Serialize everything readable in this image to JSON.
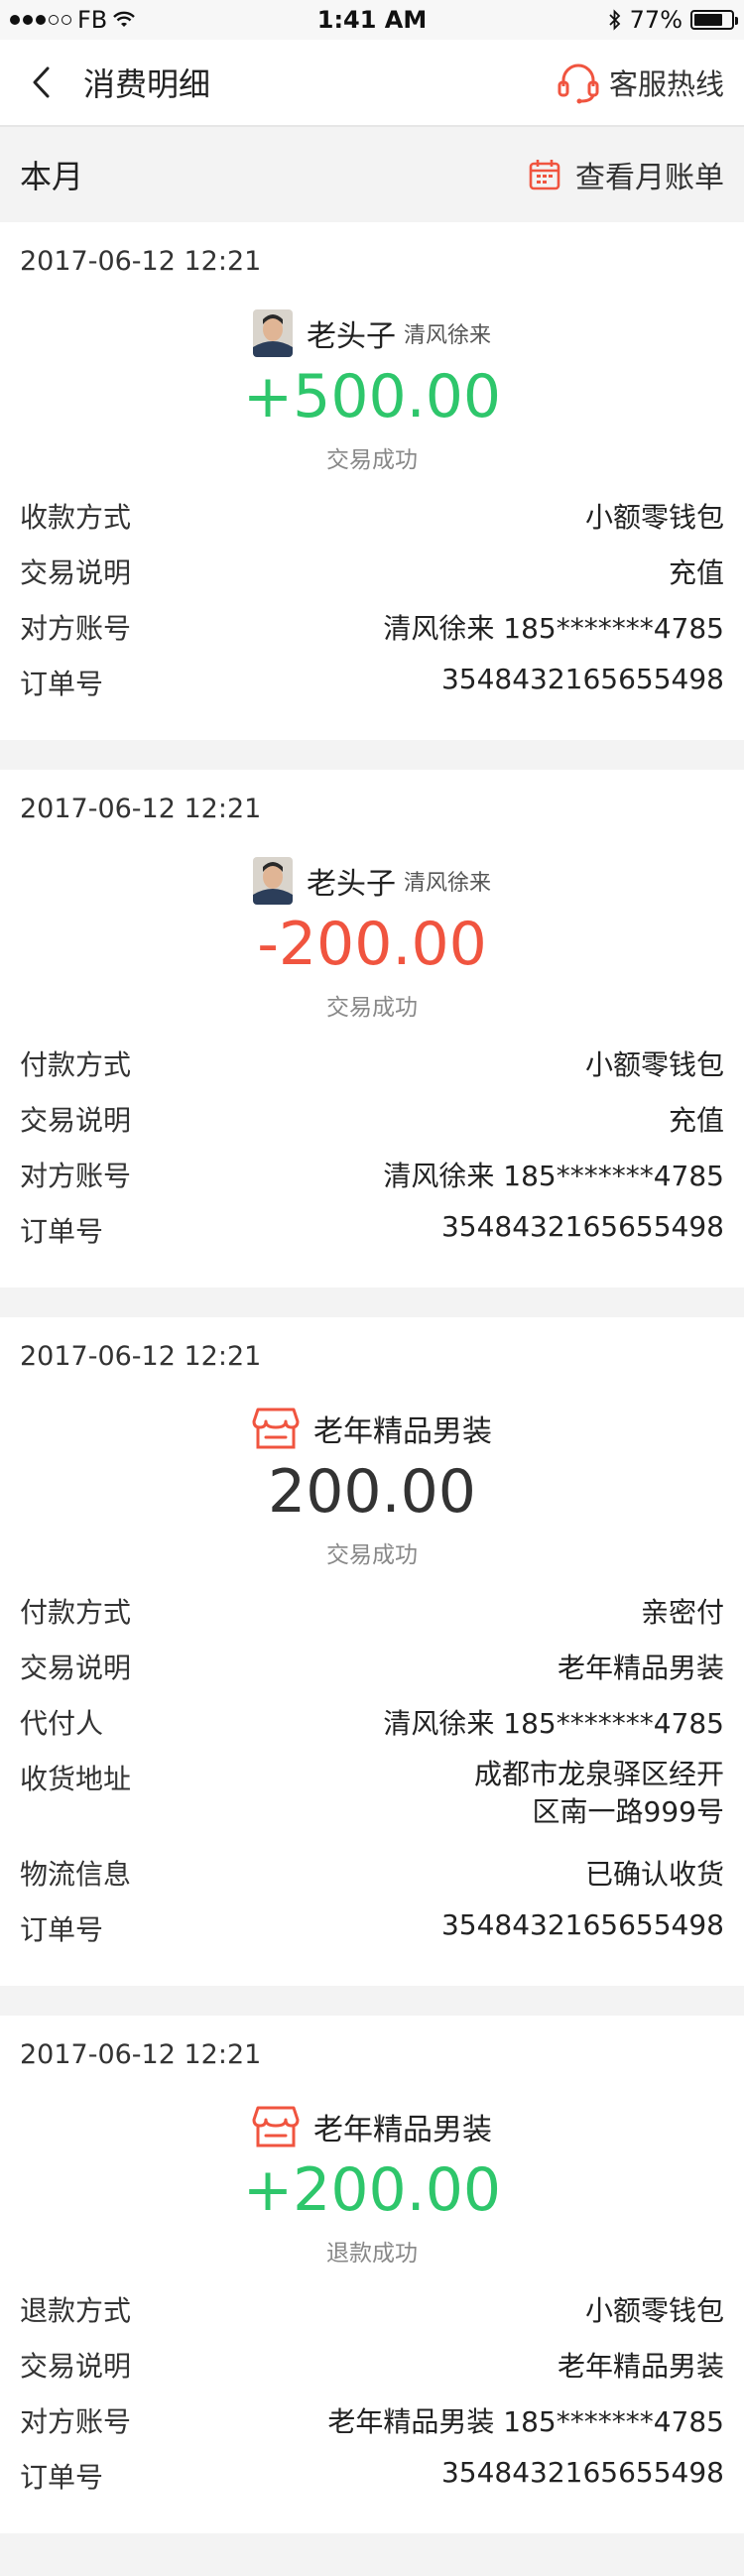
{
  "status_bar": {
    "carrier": "FB",
    "time": "1:41 AM",
    "battery": "77%",
    "battery_level": 0.77
  },
  "nav": {
    "title": "消费明细",
    "hotline": "客服热线"
  },
  "month": {
    "label": "本月",
    "bill_link": "查看月账单"
  },
  "colors": {
    "accent": "#f0543f",
    "positive": "#2ec66b",
    "negative": "#f0543f"
  },
  "transactions": [
    {
      "datetime": "2017-06-12 12:21",
      "party": "老头子",
      "party_sub": "清风徐来",
      "party_icon": "avatar",
      "amount": "+500.00",
      "status": "交易成功",
      "rows": [
        {
          "label": "收款方式",
          "value": "小额零钱包"
        },
        {
          "label": "交易说明",
          "value": "充值"
        },
        {
          "label": "对方账号",
          "value": "清风徐来 185*******4785"
        },
        {
          "label": "订单号",
          "value": "3548432165655498"
        }
      ]
    },
    {
      "datetime": "2017-06-12 12:21",
      "party": "老头子",
      "party_sub": "清风徐来",
      "party_icon": "avatar",
      "amount": "-200.00",
      "status": "交易成功",
      "rows": [
        {
          "label": "付款方式",
          "value": "小额零钱包"
        },
        {
          "label": "交易说明",
          "value": "充值"
        },
        {
          "label": "对方账号",
          "value": "清风徐来 185*******4785"
        },
        {
          "label": "订单号",
          "value": "3548432165655498"
        }
      ]
    },
    {
      "datetime": "2017-06-12 12:21",
      "party": "老年精品男装",
      "party_icon": "store-icon",
      "amount": "200.00",
      "status": "交易成功",
      "rows": [
        {
          "label": "付款方式",
          "value": "亲密付"
        },
        {
          "label": "交易说明",
          "value": "老年精品男装"
        },
        {
          "label": "代付人",
          "value": "清风徐来 185*******4785"
        },
        {
          "label": "收货地址",
          "value_line1": "成都市龙泉驿区经开",
          "value_line2": "区南一路999号"
        },
        {
          "label": "物流信息",
          "value": "已确认收货"
        },
        {
          "label": "订单号",
          "value": "3548432165655498"
        }
      ]
    },
    {
      "datetime": "2017-06-12 12:21",
      "party": "老年精品男装",
      "party_icon": "store-icon",
      "amount": "+200.00",
      "status": "退款成功",
      "rows": [
        {
          "label": "退款方式",
          "value": "小额零钱包"
        },
        {
          "label": "交易说明",
          "value": "老年精品男装"
        },
        {
          "label": "对方账号",
          "value": "老年精品男装 185*******4785"
        },
        {
          "label": "订单号",
          "value": "3548432165655498"
        }
      ]
    }
  ]
}
